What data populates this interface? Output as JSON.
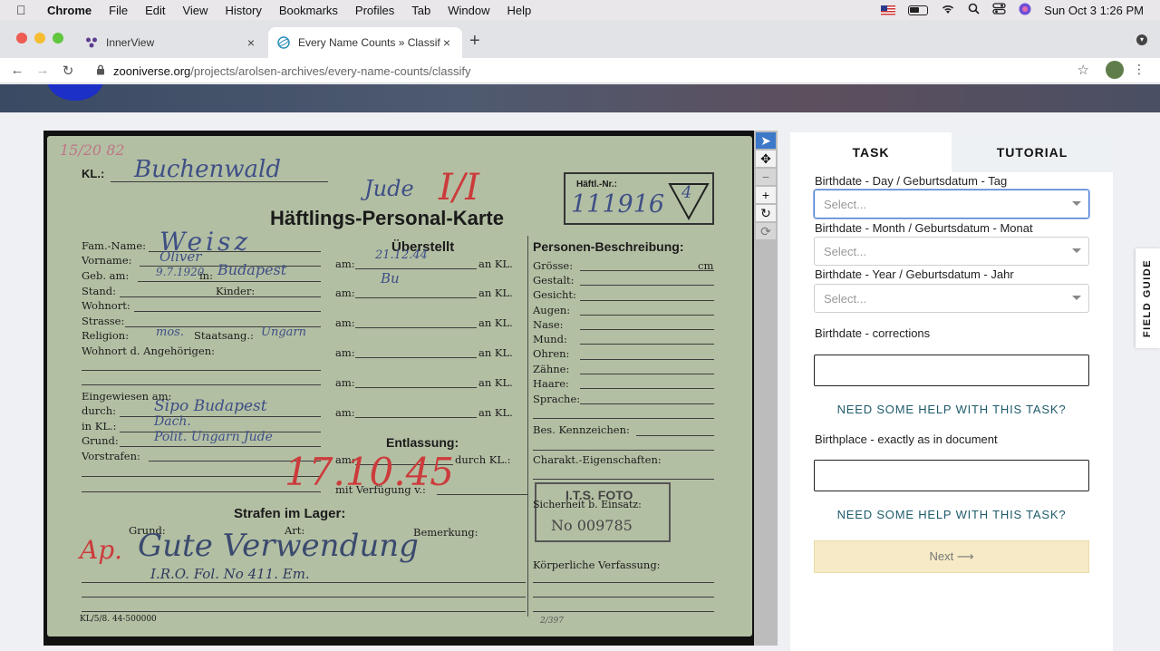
{
  "menubar": {
    "app": "Chrome",
    "items": [
      "File",
      "Edit",
      "View",
      "History",
      "Bookmarks",
      "Profiles",
      "Tab",
      "Window",
      "Help"
    ],
    "clock": "Sun Oct 3  1:26 PM"
  },
  "tabs": [
    {
      "title": "InnerView",
      "close": "×"
    },
    {
      "title": "Every Name Counts » Classify",
      "close": "×"
    }
  ],
  "newtab": "+",
  "toolbar": {
    "url_host": "zooniverse.org",
    "url_path": "/projects/arolsen-archives/every-name-counts/classify"
  },
  "card": {
    "kl_label": "KL.:",
    "kl_value": "Buchenwald",
    "top_numbers": "15/20  82",
    "jude": "Jude",
    "haftl_label": "Häftl.-Nr.:",
    "haftl_value": "111916",
    "triangle_mark": "4",
    "title": "Häftlings-Personal-Karte",
    "famname_label": "Fam.-Name:",
    "famname_value": "Weisz",
    "vorname_label": "Vorname:",
    "vorname_value": "Oliver",
    "gebam_label": "Geb. am:",
    "gebam_value": "9.7.1920",
    "in_label": "in:",
    "in_value": "Budapest",
    "stand_label": "Stand:",
    "kinder_label": "Kinder:",
    "wohnort_label": "Wohnort:",
    "strasse_label": "Strasse:",
    "religion_label": "Religion:",
    "religion_value": "mos.",
    "staatsang_label": "Staatsang.:",
    "staatsang_value": "Ungarn",
    "wohnort_angeh_label": "Wohnort d. Angehörigen:",
    "uberstellt": "Überstellt",
    "am_label": "am:",
    "an_kl_label": "an KL.",
    "uberstellt_date": "21.12.44",
    "uberstellt_kl": "Bu",
    "eingewiesen_label": "Eingewiesen am:",
    "durch_label": "durch:",
    "durch_value": "Sipo Budapest",
    "inkl_label": "in KL.:",
    "inkl_value": "Dach.",
    "grund_label": "Grund:",
    "grund_value": "Polit. Ungarn  Jude",
    "vorstrafen_label": "Vorstrafen:",
    "entlassung": "Entlassung:",
    "durch_kl_label": "durch KL.:",
    "mit_verfugung": "mit Verfügung v.:",
    "red_date": "17.10.45",
    "strafen": "Strafen im Lager:",
    "grund_col": "Grund:",
    "art_col": "Art:",
    "bemerkung_col": "Bemerkung:",
    "handwriting_bottom": "Gute Verwendung",
    "red_initial": "Ap.",
    "iro": "I.R.O. Fol. No 411. Em.",
    "personen": "Personen-Beschreibung:",
    "grosse": "Grösse:",
    "cm": "cm",
    "gestalt": "Gestalt:",
    "gesicht": "Gesicht:",
    "augen": "Augen:",
    "nase": "Nase:",
    "mund": "Mund:",
    "ohren": "Ohren:",
    "zahne": "Zähne:",
    "haare": "Haare:",
    "sprache": "Sprache:",
    "bes_kennzeichen": "Bes. Kennzeichen:",
    "charakt": "Charakt.-Eigenschaften:",
    "sicherheit": "Sicherheit b. Einsatz:",
    "stamp_top": "I.T.S. FOTO",
    "stamp_num": "No 009785",
    "korperliche": "Körperliche Verfassung:",
    "footer_code": "KL/5/8. 44-500000",
    "footer_num": "2/397"
  },
  "viewer_tools": {
    "pointer": "➤",
    "move": "✥",
    "zoom_out": "−",
    "zoom_in": "+",
    "rotate": "↻",
    "reset": "⟳"
  },
  "panel": {
    "tab_task": "TASK",
    "tab_tutorial": "TUTORIAL",
    "day_label": "Birthdate - Day / Geburtsdatum - Tag",
    "month_label": "Birthdate - Month / Geburtsdatum - Monat",
    "year_label": "Birthdate - Year / Geburtsdatum - Jahr",
    "select_placeholder": "Select...",
    "corrections_label": "Birthdate - corrections",
    "help_text": "NEED SOME HELP WITH THIS TASK?",
    "birthplace_label": "Birthplace - exactly as in document",
    "next_label": "Next ⟶"
  },
  "field_guide": "FIELD GUIDE"
}
